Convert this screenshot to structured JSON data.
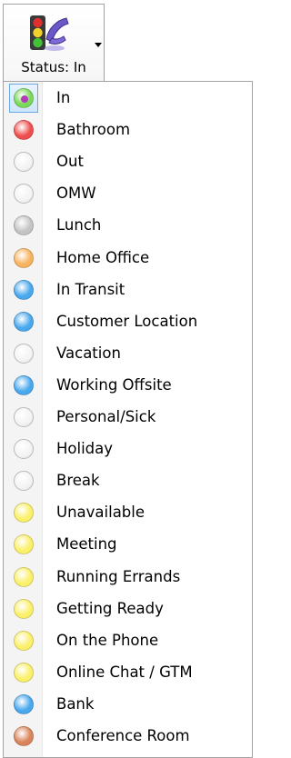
{
  "status_button": {
    "caption": "Status: In",
    "icon": "traffic-light-phone-icon",
    "dropdown_icon": "dropdown-arrow-icon"
  },
  "menu": {
    "selected_index": 0,
    "items": [
      {
        "label": "In",
        "icon": "green-status-icon",
        "color": "#7ad85a",
        "checked": true
      },
      {
        "label": "Bathroom",
        "icon": "red-status-icon",
        "color": "#ef4e4e"
      },
      {
        "label": "Out",
        "icon": "empty-status-icon",
        "color": "#ffffff"
      },
      {
        "label": "OMW",
        "icon": "empty-status-icon",
        "color": "#ffffff"
      },
      {
        "label": "Lunch",
        "icon": "gray-status-icon",
        "color": "#c4c4c4"
      },
      {
        "label": "Home Office",
        "icon": "orange-status-icon",
        "color": "#f7b35e"
      },
      {
        "label": "In Transit",
        "icon": "blue-status-icon",
        "color": "#4aa8ee"
      },
      {
        "label": "Customer Location",
        "icon": "blue-status-icon",
        "color": "#4aa8ee"
      },
      {
        "label": "Vacation",
        "icon": "empty-status-icon",
        "color": "#ffffff"
      },
      {
        "label": "Working Offsite",
        "icon": "blue-status-icon",
        "color": "#4aa8ee"
      },
      {
        "label": "Personal/Sick",
        "icon": "empty-status-icon",
        "color": "#ffffff"
      },
      {
        "label": "Holiday",
        "icon": "empty-status-icon",
        "color": "#ffffff"
      },
      {
        "label": "Break",
        "icon": "empty-status-icon",
        "color": "#ffffff"
      },
      {
        "label": "Unavailable",
        "icon": "yellow-status-icon",
        "color": "#fbf06a"
      },
      {
        "label": "Meeting",
        "icon": "yellow-status-icon",
        "color": "#fbf06a"
      },
      {
        "label": "Running Errands",
        "icon": "yellow-status-icon",
        "color": "#fbf06a"
      },
      {
        "label": "Getting Ready",
        "icon": "yellow-status-icon",
        "color": "#fbf06a"
      },
      {
        "label": "On the Phone",
        "icon": "yellow-status-icon",
        "color": "#fbf06a"
      },
      {
        "label": "Online Chat / GTM",
        "icon": "yellow-status-icon",
        "color": "#fbf06a"
      },
      {
        "label": "Bank",
        "icon": "blue-status-icon",
        "color": "#4aa8ee"
      },
      {
        "label": "Conference Room",
        "icon": "brown-status-icon",
        "color": "#d9845a"
      }
    ]
  }
}
